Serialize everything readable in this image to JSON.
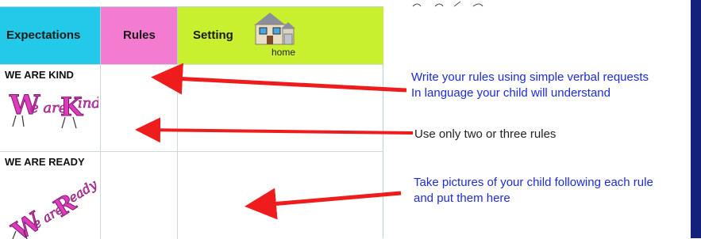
{
  "header": {
    "expectations": "Expectations",
    "rules": "Rules",
    "setting": "Setting",
    "setting_caption": "home"
  },
  "rows": [
    {
      "label": "WE ARE KIND",
      "logo_text": "We are Kind"
    },
    {
      "label": "WE ARE READY",
      "logo_text": "We are Ready"
    }
  ],
  "notes": {
    "note1_line1": "Write your rules using simple verbal requests",
    "note1_line2": "In language your child will understand",
    "note2": "Use only two or three rules",
    "note3_line1": "Take pictures of your child following each rule",
    "note3_line2": "and put them here"
  },
  "colors": {
    "expectations_bg": "#23c9e8",
    "rules_bg": "#f47cd0",
    "setting_bg": "#c9f02f",
    "arrow": "#ee1c1c",
    "note_text": "#1d2bd1",
    "side_bar": "#13217a"
  },
  "icons": [
    "house-icon",
    "red-arrow"
  ]
}
